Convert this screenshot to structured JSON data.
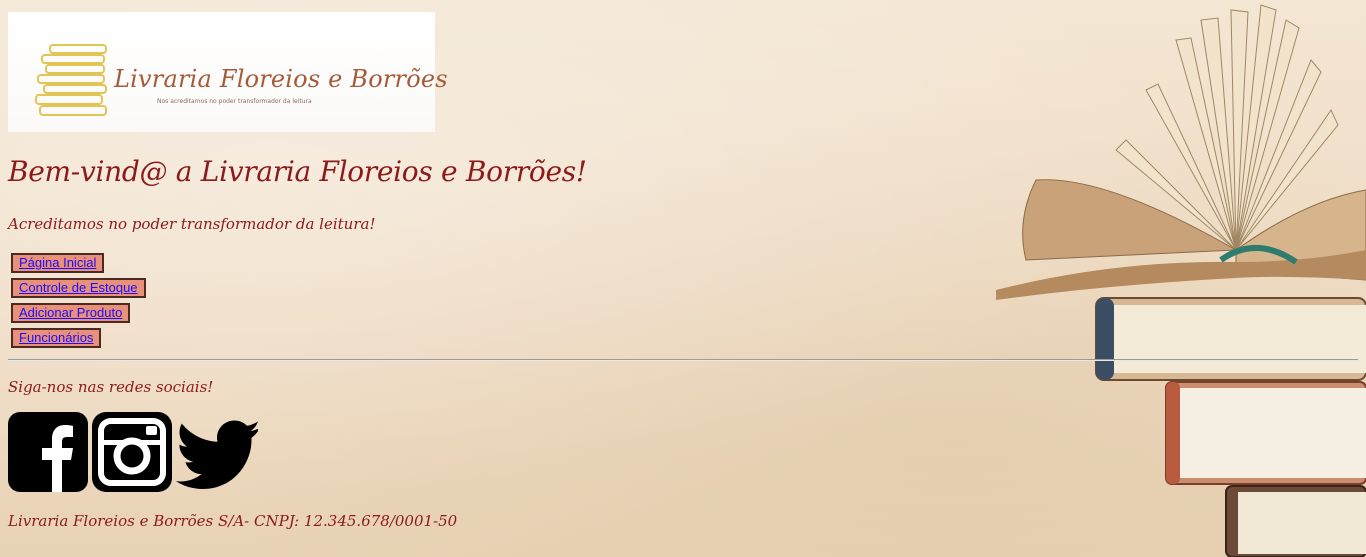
{
  "logo": {
    "title": "Livraria Floreios e Borrões",
    "tagline": "Nos acreditamos no poder transformador da leitura"
  },
  "welcome": "Bem-vind@ a Livraria Floreios e Borrões!",
  "subtitle": "Acreditamos no poder transformador da leitura!",
  "nav": {
    "items": [
      {
        "label": "Página Inicial"
      },
      {
        "label": "Controle de Estoque"
      },
      {
        "label": "Adicionar Produto"
      },
      {
        "label": "Funcionários"
      }
    ]
  },
  "social": {
    "heading": "Siga-nos nas redes sociais!",
    "icons": [
      "facebook-icon",
      "instagram-icon",
      "twitter-icon"
    ]
  },
  "footer": "Livraria Floreios e Borrões S/A- CNPJ: 12.345.678/0001-50",
  "colors": {
    "text": "#8b1a1a",
    "button_bg": "#e8907a",
    "link": "#1a0dff",
    "background": "#f3e6d3"
  }
}
